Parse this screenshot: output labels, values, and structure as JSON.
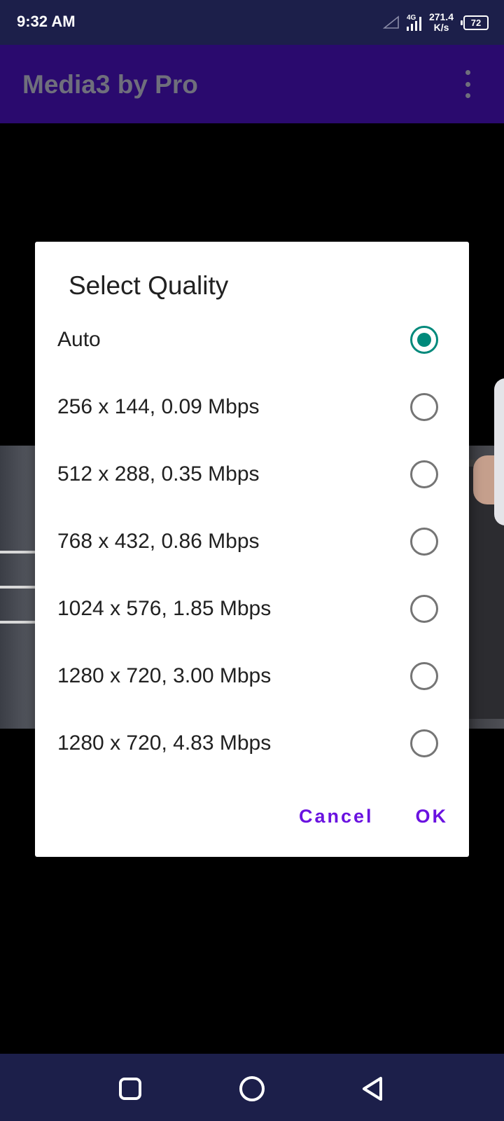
{
  "status_bar": {
    "time": "9:32 AM",
    "network": "4G",
    "net_speed_value": "271.4",
    "net_speed_unit": "K/s",
    "battery": "72"
  },
  "app_bar": {
    "title": "Media3 by Pro",
    "menu_icon": "overflow-menu-icon"
  },
  "dialog": {
    "title": "Select Quality",
    "options": [
      {
        "label": "Auto",
        "selected": true
      },
      {
        "label": "256 x 144, 0.09 Mbps",
        "selected": false
      },
      {
        "label": "512 x 288, 0.35 Mbps",
        "selected": false
      },
      {
        "label": "768 x 432, 0.86 Mbps",
        "selected": false
      },
      {
        "label": "1024 x 576, 1.85 Mbps",
        "selected": false
      },
      {
        "label": "1280 x 720, 3.00 Mbps",
        "selected": false
      },
      {
        "label": "1280 x 720, 4.83 Mbps",
        "selected": false
      }
    ],
    "cancel_label": "Cancel",
    "ok_label": "OK"
  },
  "colors": {
    "accent": "#6a12e0",
    "radio_checked": "#00897b",
    "app_bar": "#2a0a6e",
    "system_bar": "#1c1f4a"
  },
  "nav_bar": {
    "recents_icon": "square-recents-icon",
    "home_icon": "circle-home-icon",
    "back_icon": "triangle-back-icon"
  }
}
